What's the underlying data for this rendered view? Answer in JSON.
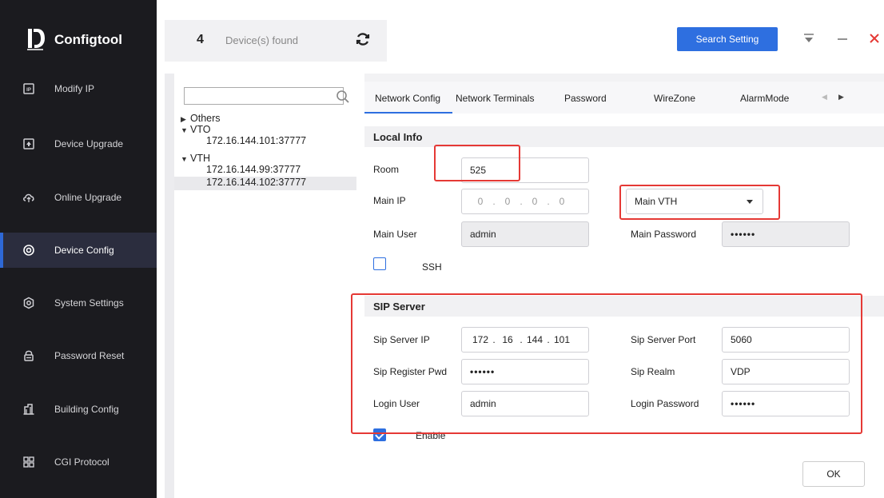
{
  "app": {
    "name": "Configtool"
  },
  "sidebar": {
    "items": [
      {
        "label": "Modify IP",
        "icon": "ip-icon"
      },
      {
        "label": "Device Upgrade",
        "icon": "upgrade-icon"
      },
      {
        "label": "Online Upgrade",
        "icon": "cloud-upgrade-icon"
      },
      {
        "label": "Device Config",
        "icon": "config-icon",
        "active": true
      },
      {
        "label": "System Settings",
        "icon": "settings-icon"
      },
      {
        "label": "Password Reset",
        "icon": "lock-icon"
      },
      {
        "label": "Building Config",
        "icon": "building-icon"
      },
      {
        "label": "CGI Protocol",
        "icon": "protocol-icon"
      }
    ]
  },
  "header": {
    "device_count": "4",
    "device_count_label": "Device(s) found",
    "search_setting_label": "Search Setting"
  },
  "colors": {
    "accent": "#2e6fe0",
    "sidebar_bg": "#1b1b1f",
    "highlight": "#e53935"
  },
  "tree": {
    "search_placeholder": "",
    "groups": [
      {
        "label": "Others",
        "expanded": false,
        "items": []
      },
      {
        "label": "VTO",
        "expanded": true,
        "items": [
          "172.16.144.101:37777"
        ]
      },
      {
        "label": "VTH",
        "expanded": true,
        "items": [
          "172.16.144.99:37777",
          "172.16.144.102:37777"
        ]
      }
    ],
    "selected": "172.16.144.102:37777"
  },
  "tabs": {
    "items": [
      "Network Config",
      "Network Terminals",
      "Password",
      "WireZone",
      "AlarmMode"
    ],
    "active": "Network Config"
  },
  "local_info": {
    "title": "Local Info",
    "room_label": "Room",
    "room_value": "525",
    "main_ip_label": "Main IP",
    "main_ip_octets": [
      "0",
      "0",
      "0",
      "0"
    ],
    "type_value": "Main VTH",
    "main_user_label": "Main User",
    "main_user_value": "admin",
    "main_password_label": "Main Password",
    "main_password_value": "••••••",
    "ssh_label": "SSH",
    "ssh_checked": false
  },
  "sip_server": {
    "title": "SIP Server",
    "ip_label": "Sip Server IP",
    "ip_octets": [
      "172",
      "16",
      "144",
      "101"
    ],
    "port_label": "Sip Server Port",
    "port_value": "5060",
    "register_pwd_label": "Sip Register Pwd",
    "register_pwd_value": "••••••",
    "realm_label": "Sip Realm",
    "realm_value": "VDP",
    "login_user_label": "Login User",
    "login_user_value": "admin",
    "login_password_label": "Login Password",
    "login_password_value": "••••••",
    "enable_label": "Enable",
    "enable_checked": true
  },
  "footer": {
    "ok_label": "OK"
  }
}
